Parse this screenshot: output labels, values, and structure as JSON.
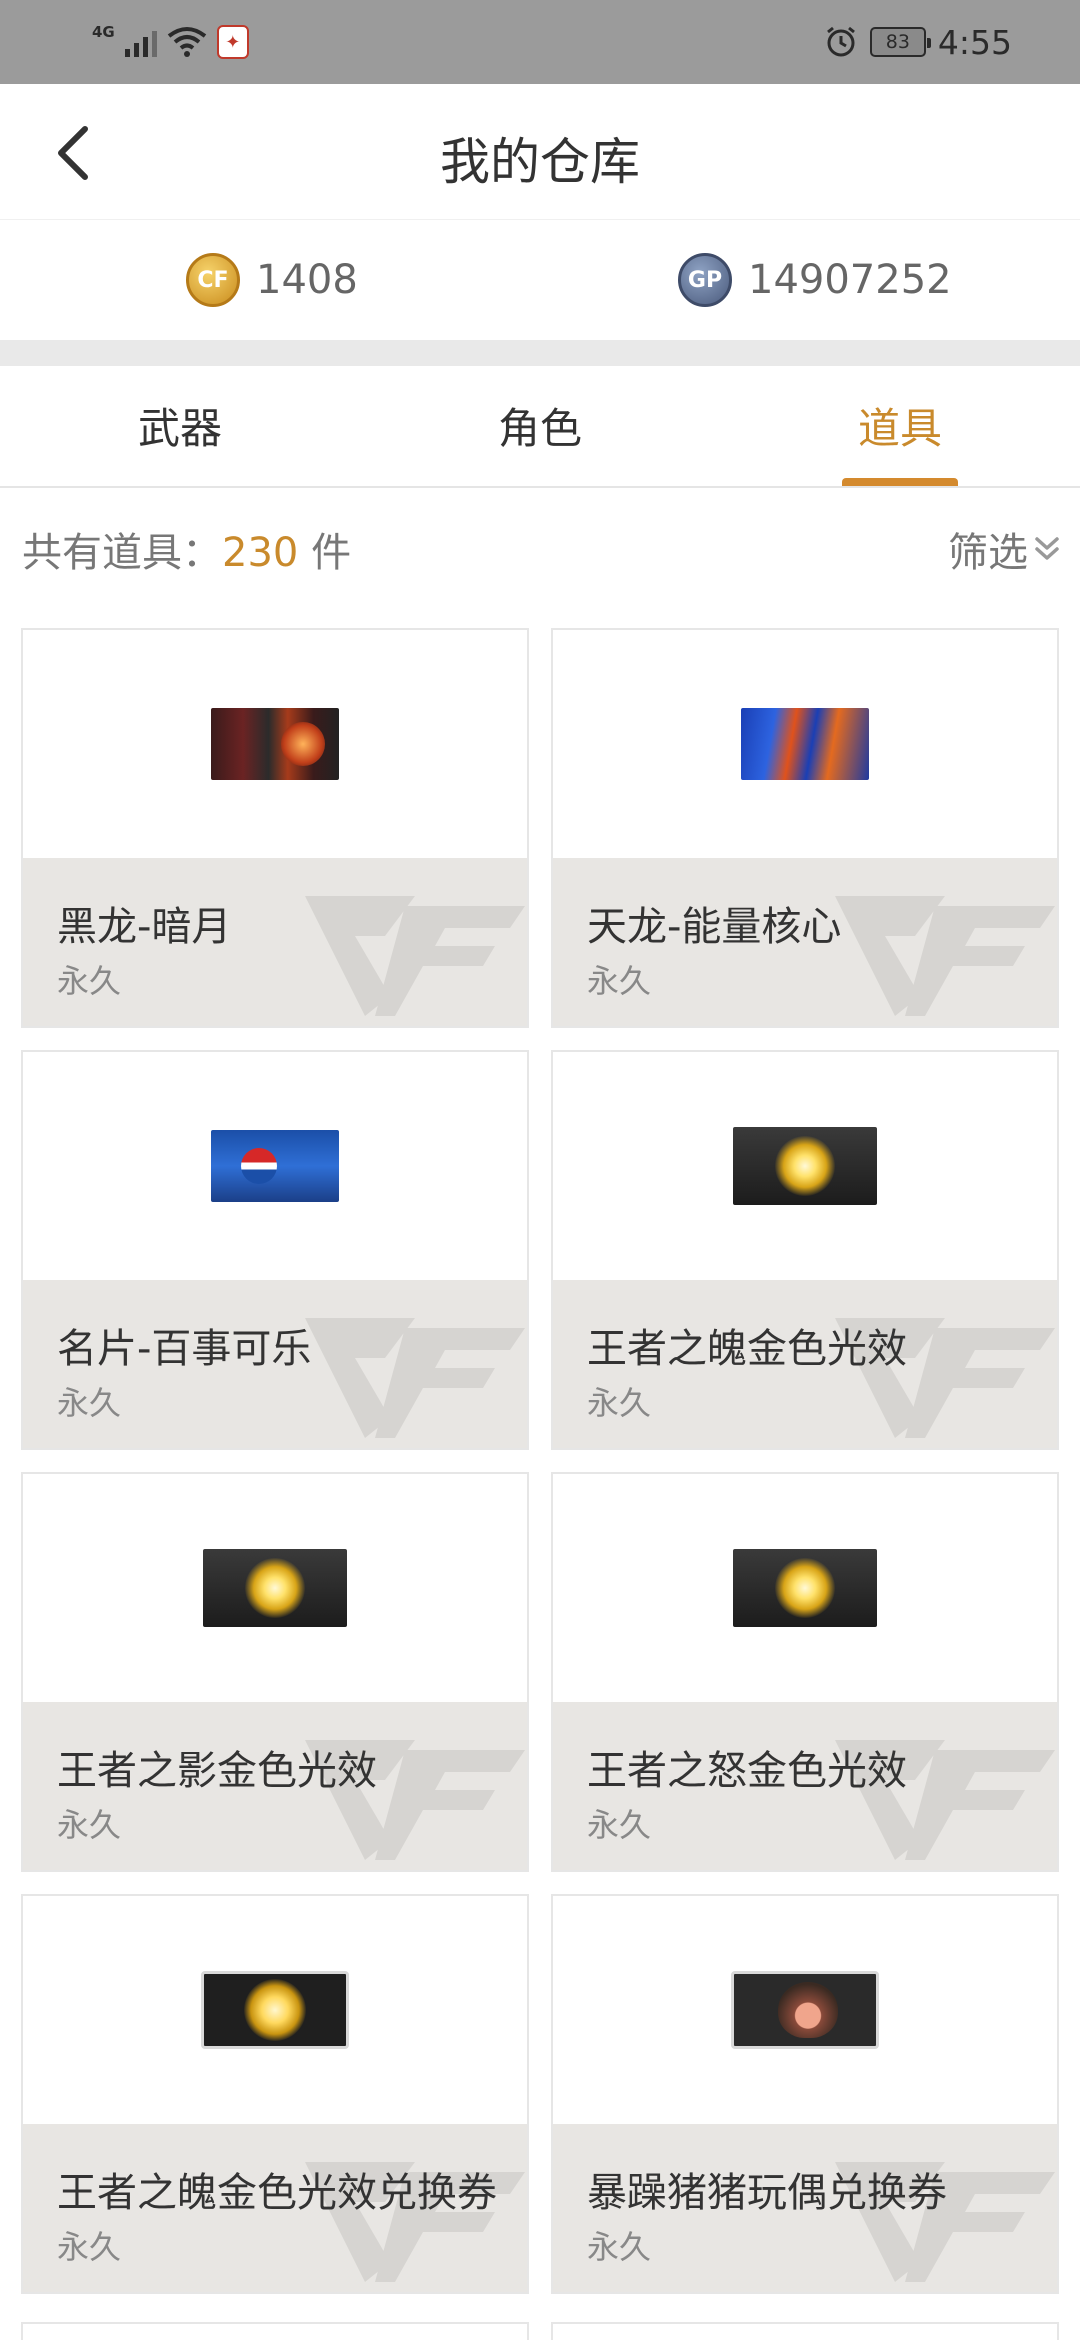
{
  "status_bar": {
    "network": "4G",
    "battery": "83",
    "time": "4:55"
  },
  "header": {
    "title": "我的仓库"
  },
  "currency": {
    "cf_points": "1408",
    "gp": "14907252",
    "gp_icon_text": "GP",
    "cf_icon_text": "CF"
  },
  "tabs": [
    {
      "label": "武器",
      "active": false
    },
    {
      "label": "角色",
      "active": false
    },
    {
      "label": "道具",
      "active": true
    }
  ],
  "filter": {
    "count_label": "共有道具：",
    "count_value": "230",
    "count_unit": " 件",
    "filter_label": "筛选"
  },
  "items": [
    {
      "name": "黑龙-暗月",
      "duration": "永久",
      "image": "weapon-black-dragon"
    },
    {
      "name": "天龙-能量核心",
      "duration": "永久",
      "image": "weapon-sky-dragon"
    },
    {
      "name": "名片-百事可乐",
      "duration": "永久",
      "image": "card-pepsi"
    },
    {
      "name": "王者之魄金色光效",
      "duration": "永久",
      "image": "gold-effect"
    },
    {
      "name": "王者之影金色光效",
      "duration": "永久",
      "image": "gold-effect"
    },
    {
      "name": "王者之怒金色光效",
      "duration": "永久",
      "image": "gold-effect"
    },
    {
      "name": "王者之魄金色光效兑换券",
      "duration": "永久",
      "image": "gold-voucher"
    },
    {
      "name": "暴躁猪猪玩偶兑换券",
      "duration": "永久",
      "image": "pig-voucher"
    }
  ],
  "colors": {
    "accent": "#c98a2c",
    "status_bar": "#9b9b9b",
    "card_info_bg": "#e8e6e3"
  }
}
